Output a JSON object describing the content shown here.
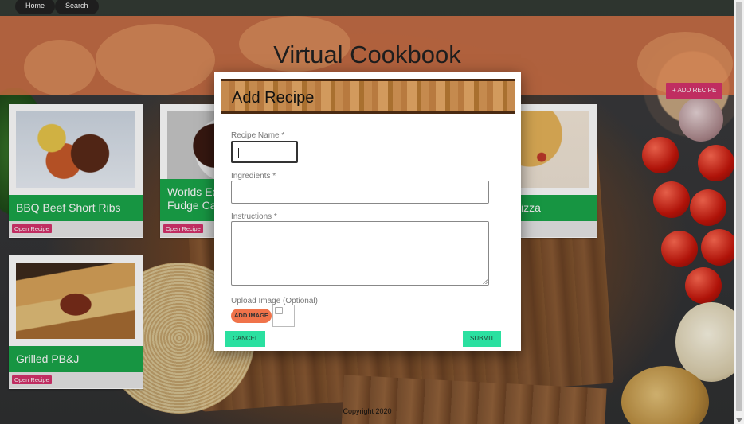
{
  "nav": {
    "home": "Home",
    "search": "Search"
  },
  "header": {
    "title": "Virtual Cookbook",
    "add_recipe_label": "+ ADD RECIPE"
  },
  "cards": [
    {
      "title": "BBQ Beef Short Ribs",
      "button": "Open Recipe"
    },
    {
      "title": "Worlds Ea          Fudge Ca",
      "button": "Open Recipe"
    },
    {
      "title": "e Pizza",
      "button": ""
    },
    {
      "title": "Grilled PB&J",
      "button": "Open Recipe"
    }
  ],
  "card_titles_split": {
    "worlds_line1": "Worlds Ea",
    "worlds_line2": "Fudge Ca"
  },
  "modal": {
    "title": "Add Recipe",
    "recipe_name_label": "Recipe Name *",
    "recipe_name_value": "",
    "ingredients_label": "Ingredients *",
    "ingredients_value": "",
    "instructions_label": "Instructions *",
    "instructions_value": "",
    "upload_label": "Upload Image (Optional)",
    "add_image_label": "ADD IMAGE",
    "cancel_label": "CANCEL",
    "submit_label": "SUBMIT"
  },
  "footer": {
    "text": "Copyright 2020"
  },
  "colors": {
    "banner": "#e27848",
    "card_band": "#1aa64a",
    "accent_pink": "#d6336c",
    "button_green": "#2be0a0",
    "add_image": "#f0734a"
  }
}
